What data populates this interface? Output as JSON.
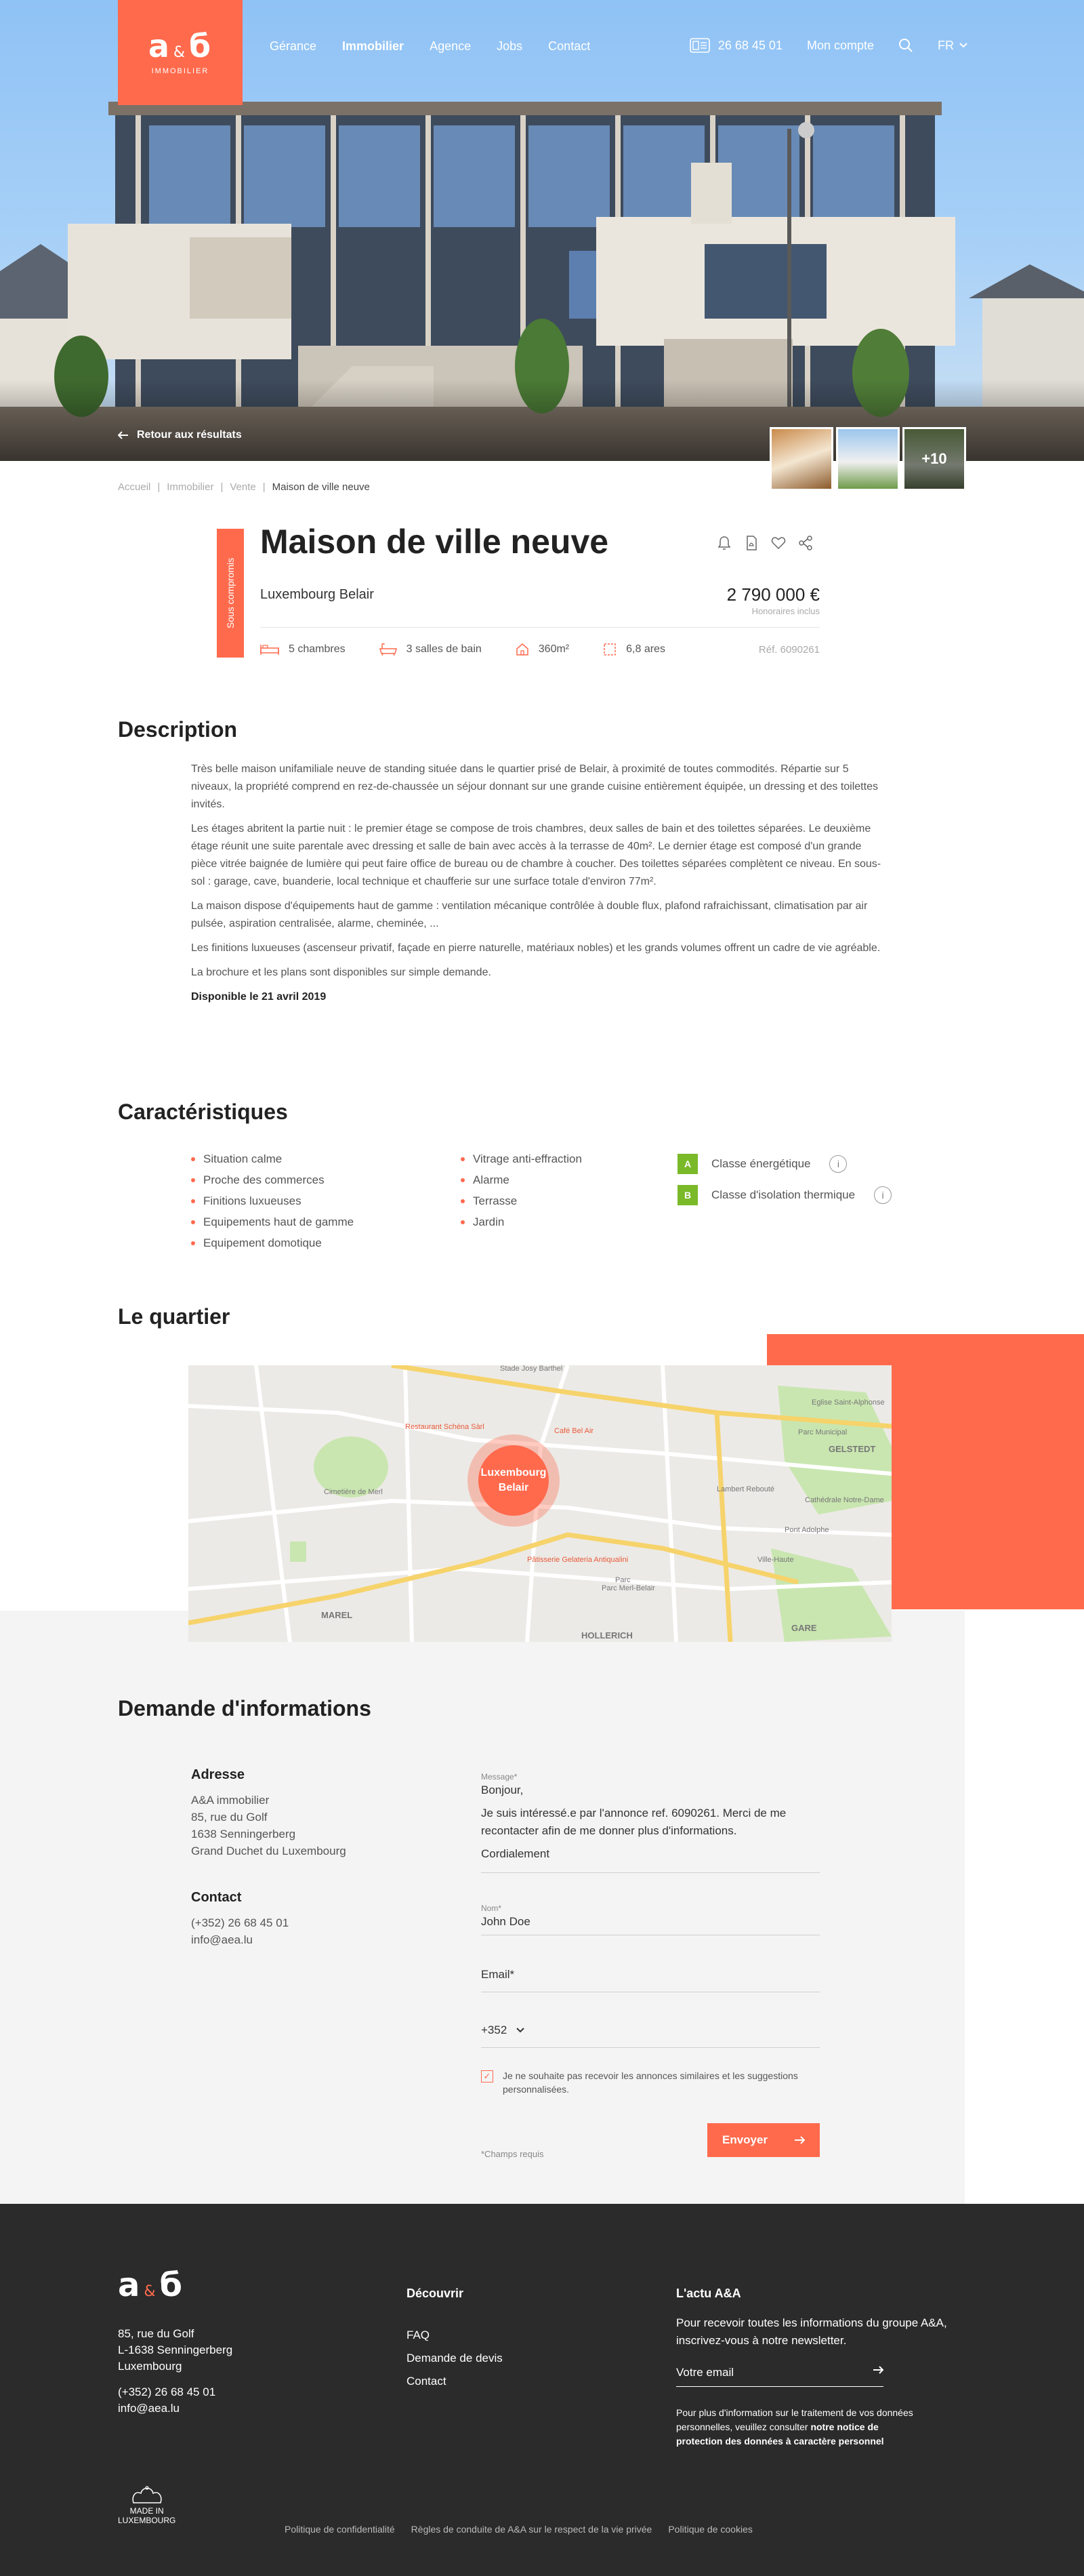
{
  "brand": {
    "name": "a&б",
    "sub": "IMMOBILIER",
    "primary": "#ff6a4d",
    "energy": "#7ab928"
  },
  "nav": {
    "items": [
      "Gérance",
      "Immobilier",
      "Agence",
      "Jobs",
      "Contact"
    ],
    "active": "Immobilier",
    "phone": "26 68 45 01",
    "account": "Mon compte",
    "lang": "FR"
  },
  "hero": {
    "back_label": "Retour aux résultats",
    "more_photos": "+10"
  },
  "breadcrumb": [
    "Accueil",
    "Immobilier",
    "Vente",
    "Maison de ville neuve"
  ],
  "listing": {
    "badge": "Sous compromis",
    "title": "Maison de ville neuve",
    "location": "Luxembourg Belair",
    "price": "2 790 000 €",
    "fees": "Honoraires inclus",
    "features": [
      "5 chambres",
      "3 salles de bain",
      "360m²",
      "6,8 ares"
    ],
    "ref": "Réf. 6090261"
  },
  "description": {
    "title": "Description",
    "paragraphs": [
      "Très belle maison unifamiliale neuve de standing située dans le quartier prisé de Belair, à proximité de toutes commodités. Répartie sur 5 niveaux, la propriété comprend en rez-de-chaussée un séjour donnant sur une grande cuisine entièrement équipée, un dressing et des toilettes invités.",
      "Les étages abritent la partie nuit : le premier étage se compose de trois chambres, deux salles de bain et des toilettes séparées. Le deuxième étage réunit une suite parentale avec dressing et salle de bain avec accès à la terrasse de 40m². Le dernier étage est composé d'un grande pièce vitrée baignée de lumière qui peut faire office de bureau ou de chambre à coucher. Des toilettes séparées complètent ce niveau. En sous-sol : garage, cave, buanderie, local technique et chaufferie sur une surface totale d'environ 77m².",
      "La maison dispose d'équipements haut de gamme : ventilation mécanique contrôlée à double flux, plafond rafraichissant, climatisation par air pulsée, aspiration centralisée, alarme, cheminée, ...",
      "Les finitions luxueuses (ascenseur privatif, façade en pierre naturelle, matériaux nobles) et les grands volumes offrent un cadre de vie agréable.",
      "La brochure et les plans sont disponibles sur simple demande."
    ],
    "availability": "Disponible le 21 avril 2019"
  },
  "characteristics": {
    "title": "Caractéristiques",
    "col1": [
      "Situation calme",
      "Proche des commerces",
      "Finitions luxueuses",
      "Equipements haut de gamme",
      "Equipement domotique"
    ],
    "col2": [
      "Vitrage anti-effraction",
      "Alarme",
      "Terrasse",
      "Jardin"
    ],
    "energy": [
      {
        "grade": "A",
        "label": "Classe énergétique"
      },
      {
        "grade": "B",
        "label": "Classe d'isolation thermique"
      }
    ]
  },
  "quartier": {
    "title": "Le quartier",
    "marker": "Luxembourg Belair",
    "labels": [
      "Stade Josy Barthel",
      "Restaurant Schéna Sàrl",
      "Café Bel Air",
      "Cimetière de Merl",
      "Parc Municipal",
      "Lambert Rebouté",
      "Cathédrale Notre-Dame",
      "Pont Adolphe",
      "Pâtisserie Gelateria Antiqualini",
      "Parc Merl-Belair",
      "Parc",
      "HOLLERICH",
      "GARE",
      "MAREL",
      "Ville-Haute",
      "Eglise Saint-Alphonse",
      "GELSTEDT"
    ]
  },
  "form": {
    "title": "Demande d'informations",
    "address_title": "Adresse",
    "address": [
      "A&A immobilier",
      "85, rue du Golf",
      "1638 Senningerberg",
      "Grand Duchet du Luxembourg"
    ],
    "contact_title": "Contact",
    "contact": [
      "(+352) 26 68 45 01",
      "info@aea.lu"
    ],
    "message_label": "Message*",
    "message": [
      "Bonjour,",
      "Je suis intéressé.e par l'annonce ref.  6090261. Merci de me recontacter afin de me donner plus d'informations.",
      "Cordialement"
    ],
    "name_label": "Nom*",
    "name_value": "John Doe",
    "email_placeholder": "Email*",
    "phone_prefix": "+352",
    "checkbox_label": "Je ne souhaite pas recevoir les annonces similaires et les suggestions personnalisées.",
    "required_note": "*Champs requis",
    "submit": "Envoyer"
  },
  "footer": {
    "address": [
      "85, rue du Golf",
      "L-1638 Senningerberg",
      "Luxembourg"
    ],
    "contact": [
      "(+352) 26 68 45 01",
      "info@aea.lu"
    ],
    "discover_title": "Découvrir",
    "discover": [
      "FAQ",
      "Demande de devis",
      "Contact"
    ],
    "news_title": "L'actu A&A",
    "news_text": "Pour recevoir toutes les informations du groupe A&A, inscrivez-vous à notre newsletter.",
    "email_placeholder": "Votre email",
    "privacy_text": "Pour plus d'information sur le traitement de vos données personnelles, veuillez consulter",
    "privacy_link": "notre notice de protection des données à caractère personnel",
    "made_in": [
      "MADE IN",
      "LUXEMBOURG"
    ],
    "legal": [
      "Politique de confidentialité",
      "Règles de conduite de A&A sur le respect de la vie privée",
      "Politique de cookies"
    ]
  }
}
